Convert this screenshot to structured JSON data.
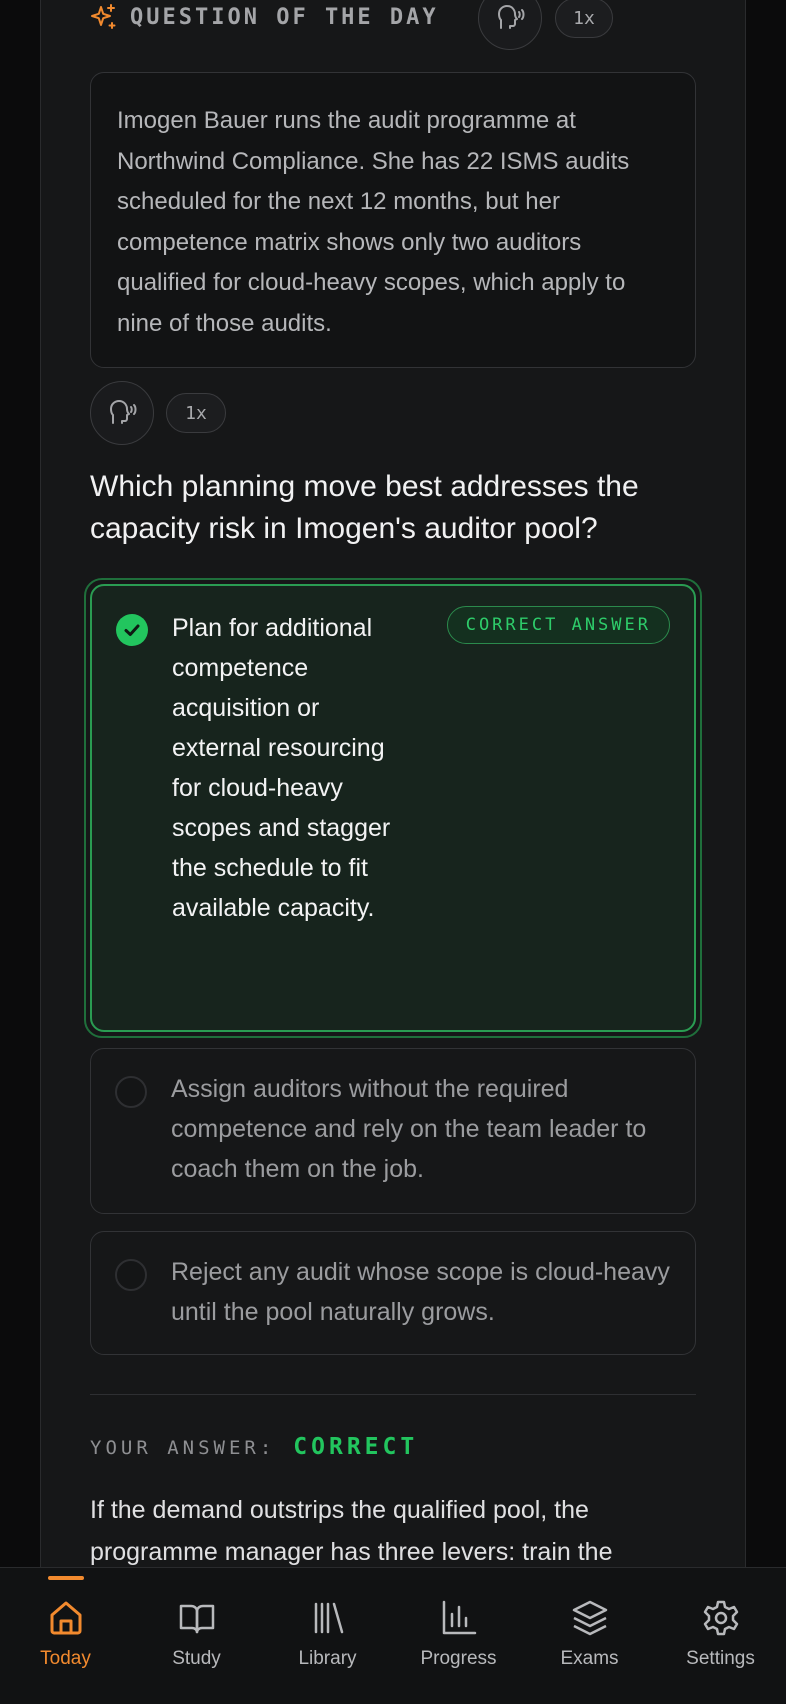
{
  "qotd": {
    "title": "QUESTION OF THE DAY",
    "speed": "1x"
  },
  "scenario": {
    "text": "Imogen Bauer runs the audit programme at Northwind Compliance. She has 22 ISMS audits scheduled for the next 12 months, but her competence matrix shows only two auditors qualified for cloud-heavy scopes, which apply to nine of those audits."
  },
  "audio": {
    "speed": "1x"
  },
  "question": {
    "text": "Which planning move best addresses the capacity risk in Imogen's auditor pool?"
  },
  "options": [
    {
      "text": "Plan for additional competence acquisition or external resourcing for cloud-heavy scopes and stagger the schedule to fit available capacity.",
      "badge": "CORRECT ANSWER",
      "state": "correct"
    },
    {
      "text": "Assign auditors without the required competence and rely on the team leader to coach them on the job.",
      "state": "unselected"
    },
    {
      "text": "Reject any audit whose scope is cloud-heavy until the pool naturally grows.",
      "state": "unselected"
    }
  ],
  "result": {
    "label": "YOUR ANSWER:",
    "value": "CORRECT"
  },
  "explanation": {
    "text": "If the demand outstrips the qualified pool, the programme manager has three levers: train the"
  },
  "tabbar": {
    "tabs": [
      {
        "label": "Today",
        "icon": "home-icon",
        "active": true
      },
      {
        "label": "Study",
        "icon": "book-icon"
      },
      {
        "label": "Library",
        "icon": "library-icon"
      },
      {
        "label": "Progress",
        "icon": "bar-chart-icon"
      },
      {
        "label": "Exams",
        "icon": "layers-icon"
      },
      {
        "label": "Settings",
        "icon": "gear-icon"
      }
    ]
  },
  "colors": {
    "accent": "#f28a2e",
    "correct": "#22c55e"
  }
}
